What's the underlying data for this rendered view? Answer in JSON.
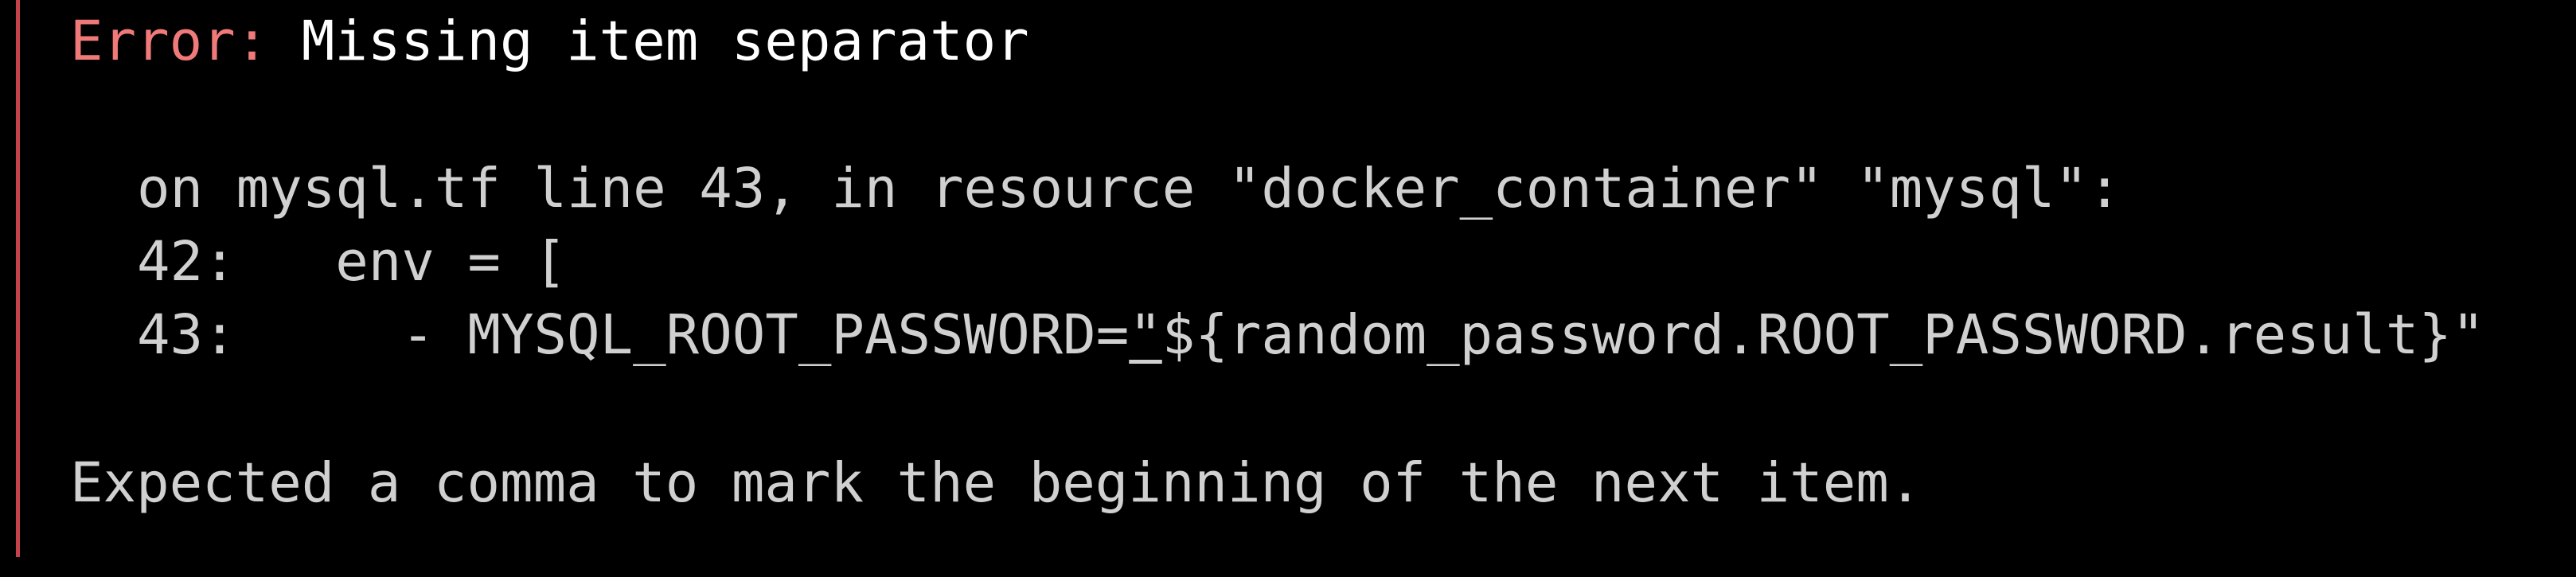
{
  "error": {
    "label": "Error:",
    "title": " Missing item separator"
  },
  "location": {
    "line": "on mysql.tf line 43, in resource \"docker_container\" \"mysql\":"
  },
  "code": {
    "line1": "42:   env = [",
    "line2_prefix": "43:     - MYSQL_ROOT_PASSWORD=",
    "line2_highlight": "\"",
    "line2_suffix": "${random_password.ROOT_PASSWORD.result}\""
  },
  "message": {
    "text": "Expected a comma to mark the beginning of the next item."
  },
  "colors": {
    "background": "#000000",
    "error_label": "#f07a7a",
    "bar": "#c4424a",
    "text": "#d6d6d6",
    "title": "#ffffff"
  }
}
